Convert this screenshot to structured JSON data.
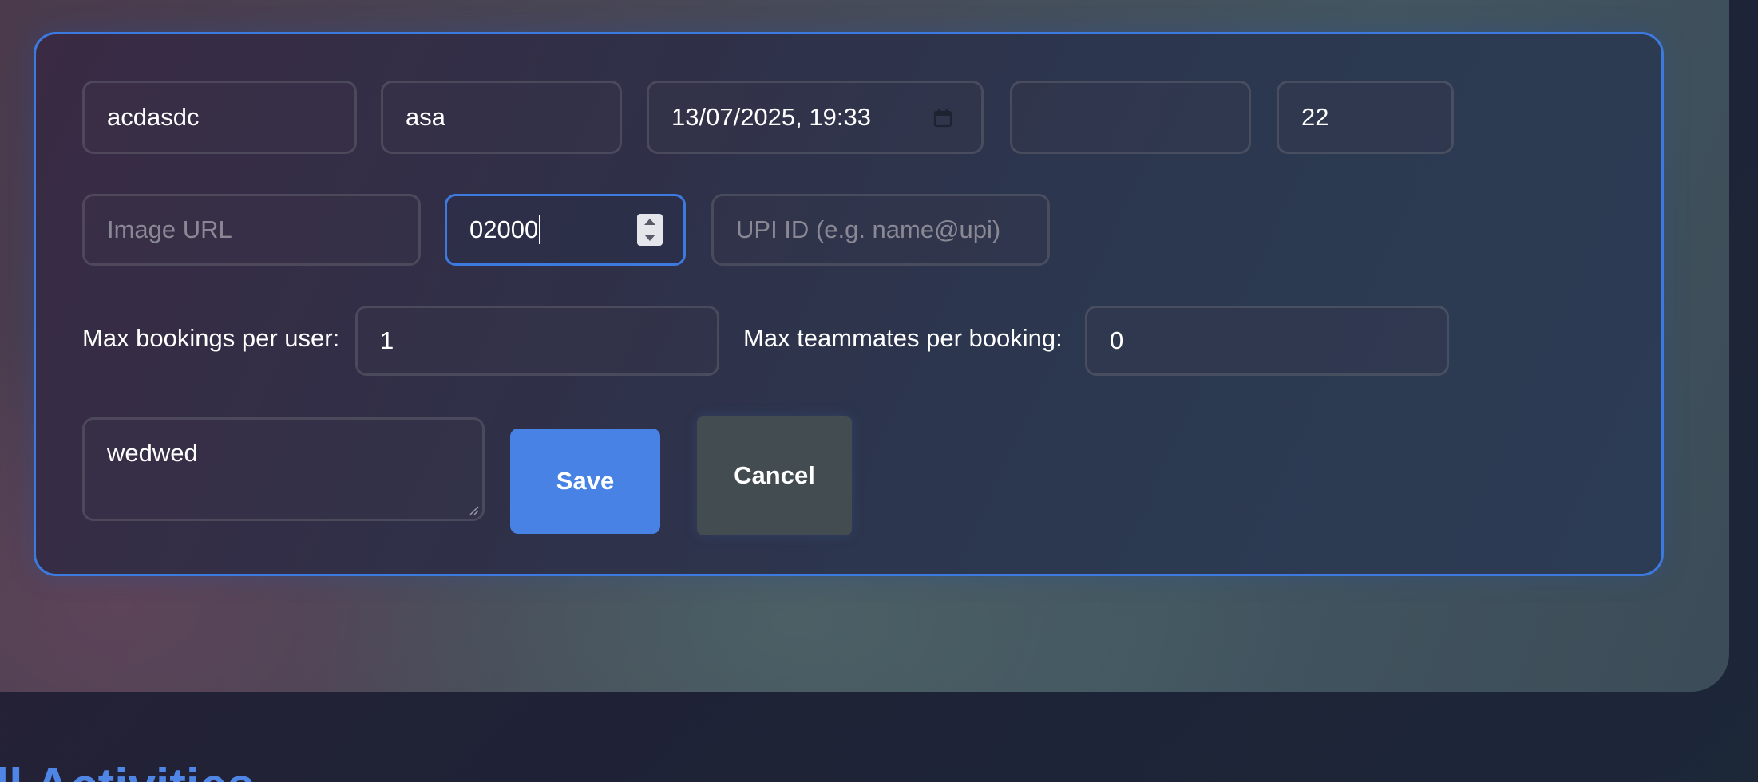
{
  "form": {
    "title_value": "acdasdc",
    "location_value": "asa",
    "datetime_value": "13/07/2025, 19:33",
    "empty_value": "",
    "slots_value": "22",
    "image_url_placeholder": "Image URL",
    "price_value": "02000",
    "upi_placeholder": "UPI ID (e.g. name@upi)",
    "max_bookings_label": "Max bookings per user:",
    "max_bookings_value": "1",
    "max_teammates_label": "Max teammates per booking:",
    "max_teammates_value": "0",
    "description_value": "wedwed",
    "save_label": "Save",
    "cancel_label": "Cancel"
  },
  "section": {
    "heading": "ll Activities"
  },
  "colors": {
    "accent": "#3d7ae0",
    "save_button": "#4782e4",
    "cancel_button": "#434c50",
    "heading": "#4f86e6"
  },
  "icons": {
    "datetime": "calendar-icon",
    "number": "spinner-icon",
    "textarea": "resize-grip-icon"
  }
}
